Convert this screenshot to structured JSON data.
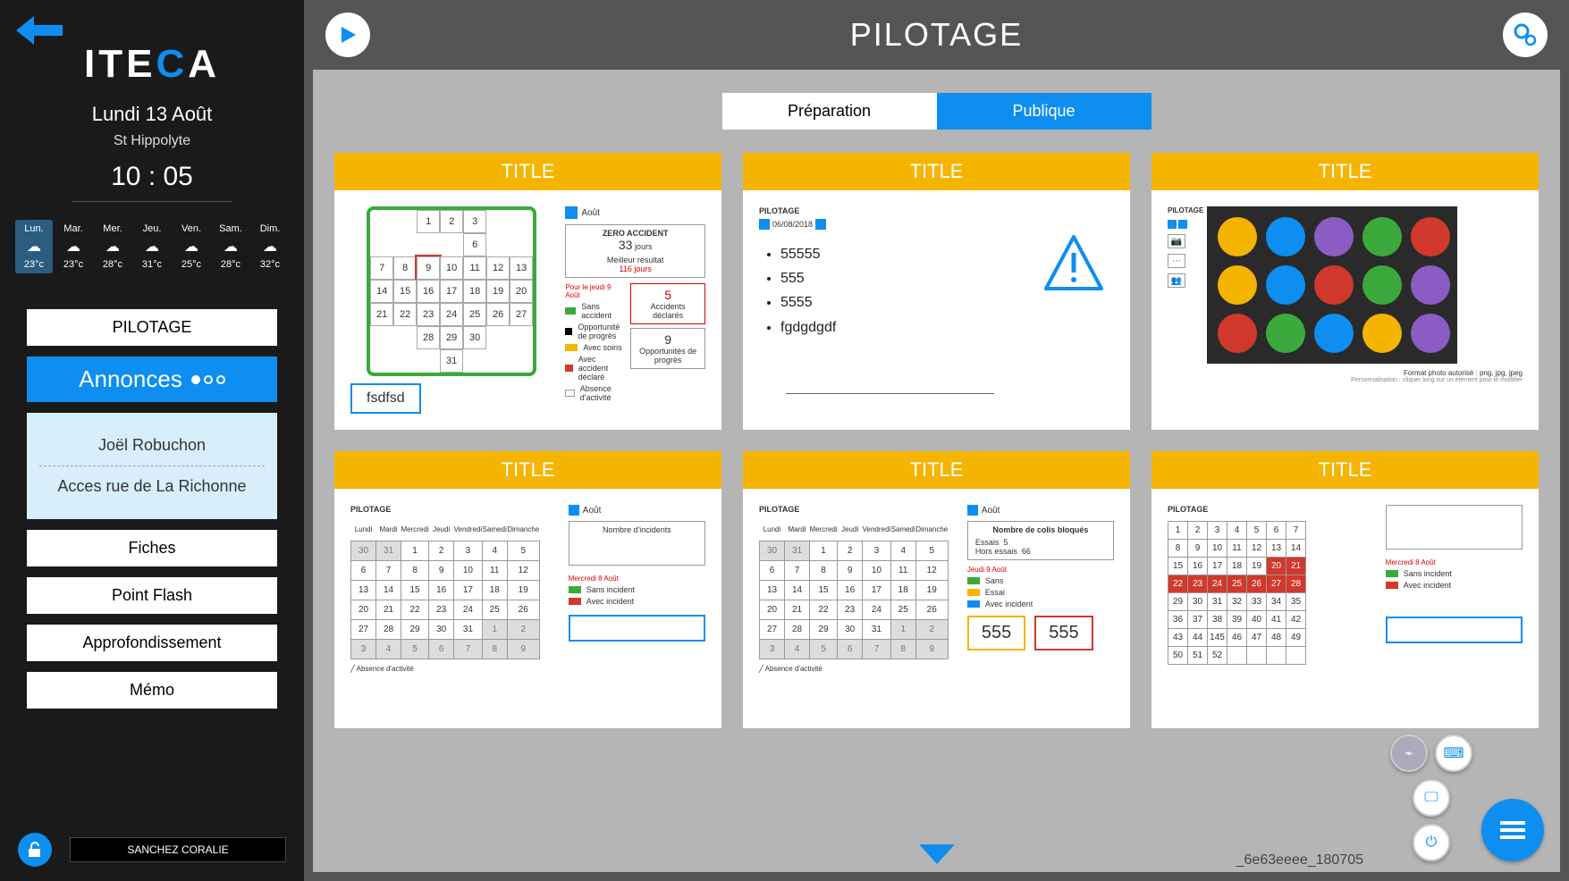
{
  "sidebar": {
    "logo_prefix": "ITE",
    "logo_c": "C",
    "logo_suffix": "A",
    "date": "Lundi 13 Août",
    "location": "St Hippolyte",
    "time": "10 : 05",
    "weather": [
      {
        "day": "Lun.",
        "temp": "23°c",
        "selected": true
      },
      {
        "day": "Mar.",
        "temp": "23°c",
        "selected": false
      },
      {
        "day": "Mer.",
        "temp": "28°c",
        "selected": false
      },
      {
        "day": "Jeu.",
        "temp": "31°c",
        "selected": false
      },
      {
        "day": "Ven.",
        "temp": "25°c",
        "selected": false
      },
      {
        "day": "Sam.",
        "temp": "28°c",
        "selected": false
      },
      {
        "day": "Dim.",
        "temp": "32°c",
        "selected": false
      }
    ],
    "nav": {
      "pilotage": "PILOTAGE",
      "annonces": "Annonces",
      "fiches": "Fiches",
      "point_flash": "Point Flash",
      "approfondissement": "Approfondissement",
      "memo": "Mémo"
    },
    "announcements": [
      "Joël Robuchon",
      "Acces rue de La Richonne"
    ],
    "user": "SANCHEZ CORALIE"
  },
  "main": {
    "title": "PILOTAGE",
    "tabs": {
      "preparation": "Préparation",
      "publique": "Publique"
    },
    "card_title": "TITLE",
    "version": "_6e63eeee_180705",
    "card1": {
      "tag": "fsdfsd",
      "month": "Août",
      "zero_title": "ZERO ACCIDENT",
      "zero_value": "33",
      "zero_unit": "jours",
      "best_label": "Meilleur résultat",
      "best_value": "116",
      "best_unit": "jours",
      "box5": "5",
      "box5_label": "Accidents déclarés",
      "box9": "9",
      "box9_label": "Opportunités de progrès",
      "legend_title": "Pour le jeudi 9 Août",
      "legend": [
        "Sans accident",
        "Opportunité de progrès",
        "Avec soins",
        "Avec accident déclaré",
        "Absence d'activité"
      ]
    },
    "card2": {
      "label": "PILOTAGE",
      "date": "06/08/2018",
      "items": [
        "55555",
        "555",
        "5555",
        "fgdgdgdf"
      ]
    },
    "card3": {
      "label": "PILOTAGE",
      "caption": "Format photo autorisé : png, jpg, jpeg",
      "caption2": "Personnalisation : cliquer long sur un élément pour le modifier"
    },
    "card4": {
      "label": "PILOTAGE",
      "month": "Août",
      "days": [
        "Lundi",
        "Mardi",
        "Mercredi",
        "Jeudi",
        "Vendredi",
        "Samedi",
        "Dimanche"
      ],
      "chart_title": "Nombre d'incidents",
      "legend_title": "Mercredi 8 Août",
      "legend": [
        "Sans incident",
        "Avec incident"
      ],
      "footnote": "Absence d'activité"
    },
    "card5": {
      "label": "PILOTAGE",
      "month": "Août",
      "days": [
        "Lundi",
        "Mardi",
        "Mercredi",
        "Jeudi",
        "Vendredi",
        "Samedi",
        "Dimanche"
      ],
      "chart_title": "Nombre de colis bloqués",
      "essais_label": "Essais",
      "essais_value": "5",
      "hors_label": "Hors essais",
      "hors_value": "66",
      "legend_title": "Jeudi 9 Août",
      "legend": [
        "Sans",
        "Essai",
        "Avec incident"
      ],
      "input1": "555",
      "input2": "555",
      "footnote": "Absence d'activité"
    },
    "card6": {
      "label": "PILOTAGE",
      "legend_title": "Mercredi 8 Août",
      "legend": [
        "Sans incident",
        "Avec incident"
      ]
    }
  },
  "chart_data": [
    {
      "type": "table",
      "title": "card1-cross-calendar",
      "rows": [
        [
          "",
          "",
          "1",
          "2",
          "3",
          "",
          ""
        ],
        [
          "",
          "",
          "",
          "",
          "6",
          "",
          ""
        ],
        [
          "7",
          "8",
          "9",
          "10",
          "11",
          "12",
          "13"
        ],
        [
          "14",
          "15",
          "16",
          "17",
          "18",
          "19",
          "20"
        ],
        [
          "21",
          "22",
          "23",
          "24",
          "25",
          "26",
          "27"
        ],
        [
          "",
          "",
          "28",
          "29",
          "30",
          "",
          ""
        ],
        [
          "",
          "",
          "",
          "31",
          "",
          "",
          ""
        ]
      ]
    },
    {
      "type": "table",
      "title": "card4-calendar",
      "headers": [
        "Lundi",
        "Mardi",
        "Mercredi",
        "Jeudi",
        "Vendredi",
        "Samedi",
        "Dimanche"
      ],
      "rows": [
        [
          30,
          31,
          1,
          2,
          3,
          4,
          5
        ],
        [
          6,
          7,
          8,
          9,
          10,
          11,
          12
        ],
        [
          13,
          14,
          15,
          16,
          17,
          18,
          19
        ],
        [
          20,
          21,
          22,
          23,
          24,
          25,
          26
        ],
        [
          27,
          28,
          29,
          30,
          31,
          1,
          2
        ],
        [
          3,
          4,
          5,
          6,
          7,
          8,
          9
        ]
      ]
    },
    {
      "type": "table",
      "title": "card5-calendar",
      "headers": [
        "Lundi",
        "Mardi",
        "Mercredi",
        "Jeudi",
        "Vendredi",
        "Samedi",
        "Dimanche"
      ],
      "rows": [
        [
          30,
          31,
          1,
          2,
          3,
          4,
          5
        ],
        [
          6,
          7,
          8,
          9,
          10,
          11,
          12
        ],
        [
          13,
          14,
          15,
          16,
          17,
          18,
          19
        ],
        [
          20,
          21,
          22,
          23,
          24,
          25,
          26
        ],
        [
          27,
          28,
          29,
          30,
          31,
          1,
          2
        ],
        [
          3,
          4,
          5,
          6,
          7,
          8,
          9
        ]
      ]
    },
    {
      "type": "table",
      "title": "card6-calendar",
      "rows": [
        [
          1,
          2,
          3,
          4,
          5,
          6,
          7
        ],
        [
          8,
          9,
          10,
          11,
          12,
          13,
          14
        ],
        [
          15,
          16,
          17,
          18,
          19,
          20,
          21
        ],
        [
          22,
          23,
          24,
          25,
          26,
          27,
          28
        ],
        [
          29,
          30,
          31,
          32,
          33,
          34,
          35
        ],
        [
          36,
          37,
          38,
          39,
          40,
          41,
          42
        ],
        [
          43,
          44,
          145,
          46,
          47,
          48,
          49
        ],
        [
          50,
          51,
          52,
          "",
          "",
          "",
          ""
        ]
      ]
    }
  ]
}
